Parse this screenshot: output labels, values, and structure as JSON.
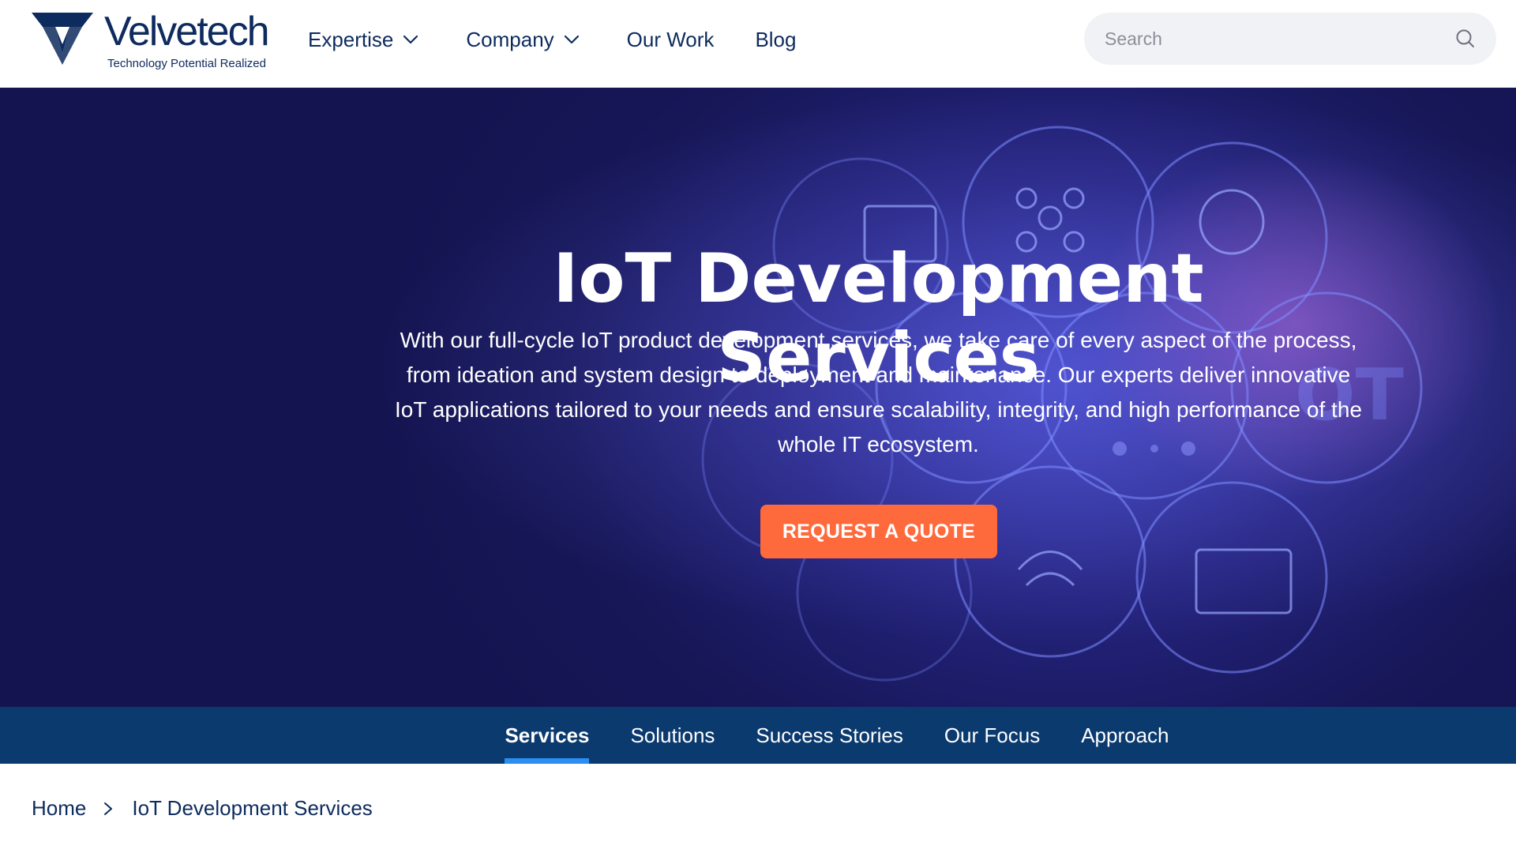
{
  "brand": {
    "name": "Velvetech",
    "tagline": "Technology Potential Realized",
    "color": "#0d2b5e"
  },
  "nav": {
    "items": [
      {
        "label": "Expertise",
        "has_dropdown": true
      },
      {
        "label": "Company",
        "has_dropdown": true
      },
      {
        "label": "Our Work",
        "has_dropdown": false
      },
      {
        "label": "Blog",
        "has_dropdown": false
      }
    ]
  },
  "search": {
    "placeholder": "Search",
    "value": "",
    "icon": "search-icon"
  },
  "hero": {
    "title": "IoT Development Services",
    "description": "With our full-cycle IoT product development services, we take care of every aspect of the process, from ideation and system design to deployment and maintenance. Our experts deliver innovative IoT applications tailored to your needs and ensure scalability, integrity, and high performance of the whole IT ecosystem.",
    "cta_label": "REQUEST A QUOTE",
    "cta_color": "#ff6a3d",
    "background_color": "#1a1a5e"
  },
  "subnav": {
    "background_color": "#0b3a6f",
    "accent_color": "#2b8ef0",
    "tabs": [
      {
        "label": "Services",
        "active": true
      },
      {
        "label": "Solutions",
        "active": false
      },
      {
        "label": "Success Stories",
        "active": false
      },
      {
        "label": "Our Focus",
        "active": false
      },
      {
        "label": "Approach",
        "active": false
      }
    ]
  },
  "breadcrumb": {
    "items": [
      "Home",
      "IoT Development Services"
    ],
    "separator_icon": "chevron-right-icon"
  }
}
